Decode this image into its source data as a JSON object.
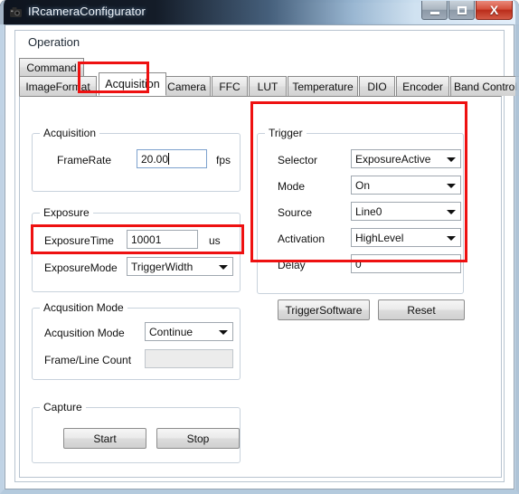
{
  "window": {
    "title": "IRcameraConfigurator",
    "icon": "camera-icon",
    "minimize_label": "",
    "maximize_label": "",
    "close_label": "X"
  },
  "menubar": {
    "items": [
      {
        "label": "Operation"
      }
    ]
  },
  "tabs": {
    "row1": [
      {
        "label": "Command",
        "selected": false
      }
    ],
    "row2": [
      {
        "label": "ImageFormat",
        "selected": false
      },
      {
        "label": "Acquisition",
        "selected": true
      },
      {
        "label": "Camera",
        "selected": false
      },
      {
        "label": "FFC",
        "selected": false
      },
      {
        "label": "LUT",
        "selected": false
      },
      {
        "label": "Temperature",
        "selected": false
      },
      {
        "label": "DIO",
        "selected": false
      },
      {
        "label": "Encoder",
        "selected": false
      },
      {
        "label": "Band Control",
        "selected": false
      }
    ]
  },
  "acquisition_group": {
    "title": "Acquisition",
    "framerate_label": "FrameRate",
    "framerate_value": "20.00",
    "framerate_unit": "fps"
  },
  "exposure_group": {
    "title": "Exposure",
    "exposuretime_label": "ExposureTime",
    "exposuretime_value": "10001",
    "exposuretime_unit": "us",
    "exposuremode_label": "ExposureMode",
    "exposuremode_value": "TriggerWidth"
  },
  "acquisition_mode_group": {
    "title": "Acqusition Mode",
    "mode_label": "Acqusition Mode",
    "mode_value": "Continue",
    "frameline_label": "Frame/Line Count",
    "frameline_value": ""
  },
  "capture_group": {
    "title": "Capture",
    "start_label": "Start",
    "stop_label": "Stop"
  },
  "trigger_group": {
    "title": "Trigger",
    "selector_label": "Selector",
    "selector_value": "ExposureActive",
    "mode_label": "Mode",
    "mode_value": "On",
    "source_label": "Source",
    "source_value": "Line0",
    "activation_label": "Activation",
    "activation_value": "HighLevel",
    "delay_label": "Delay",
    "delay_value": "0",
    "triggersoftware_label": "TriggerSoftware",
    "reset_label": "Reset"
  },
  "annotations": {
    "highlight_color": "#ee1111",
    "boxes": [
      {
        "name": "acquisition-tab-highlight"
      },
      {
        "name": "exposure-mode-highlight"
      },
      {
        "name": "trigger-group-highlight"
      }
    ]
  }
}
